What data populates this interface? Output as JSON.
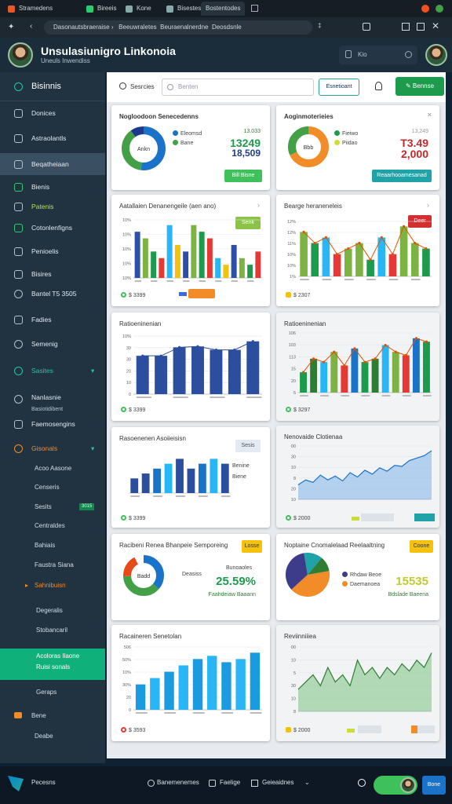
{
  "browser": {
    "tabs": [
      {
        "label": "Stramedens"
      },
      {
        "label": "Bireeis"
      },
      {
        "label": "Kone"
      },
      {
        "label": "Bisestes"
      },
      {
        "label": "Bostentodes"
      }
    ],
    "url": "Dasonautsbraeraise",
    "url_parts": [
      "Beeuwraletes",
      "Beuraenalnerdne",
      "Deosdsnle"
    ]
  },
  "app": {
    "title": "Unsulasiunigro Linkonoia",
    "subtitle": "Uneuls Inwendiss",
    "search_chip": "Kio"
  },
  "sidebar": {
    "header": "Bisinnis",
    "items": [
      {
        "label": "Donices"
      },
      {
        "label": "Astraolantls"
      },
      {
        "label": "Beqatheiaan"
      },
      {
        "label": "Bienis"
      },
      {
        "label": "Patenis"
      },
      {
        "label": "Cotonlenfigns"
      },
      {
        "label": "Penioelis"
      },
      {
        "label": "Bisires"
      },
      {
        "label": "Bantel T5 3505"
      },
      {
        "label": "Fadies"
      },
      {
        "label": "Semenig"
      },
      {
        "label": "Sasites"
      },
      {
        "label": "Nanlasnie"
      },
      {
        "label": "Basiotidibent"
      },
      {
        "label": "Faemosengins"
      },
      {
        "label": "Gisonals"
      }
    ],
    "sub_items": [
      {
        "label": "Acoo Aasone"
      },
      {
        "label": "Censeris"
      },
      {
        "label": "Sesits",
        "badge": "3015"
      },
      {
        "label": "Centraldes"
      },
      {
        "label": "Bahiais"
      },
      {
        "label": "Faustra Siana"
      },
      {
        "label": "Sahnibuisn"
      },
      {
        "label": "Degeralis"
      },
      {
        "label": "Stobancaril"
      },
      {
        "label": "Acoloras Ilaone"
      },
      {
        "label": "Ruisi sonals"
      },
      {
        "label": "Geraps"
      },
      {
        "label": "Bene"
      },
      {
        "label": "Deabe"
      }
    ]
  },
  "toolbar": {
    "search_label": "Sesrcies",
    "search_placeholder": "Benten",
    "filter_button": "Esnetioant",
    "primary_button": "Bennse"
  },
  "cards": [
    {
      "title": "Nogloodoon Senecedenns",
      "legend": [
        "Eleomsd",
        "Bane"
      ],
      "value1": "13.033",
      "value2": "13249",
      "value3": "18,509",
      "button": "Bill Bisne",
      "donut_center": "Ankn"
    },
    {
      "title": "Aoginmoterieies",
      "legend": [
        "Fieiwo",
        "Piidao"
      ],
      "value1": "13,249",
      "value2": "T3.49",
      "value3": "2,000",
      "button": "Reaarhooamesanad",
      "donut_center": "Bbb"
    },
    {
      "title": "Aatallaien Denanengeile (aen ano)",
      "badge": "Senk",
      "footer": "$ 3399"
    },
    {
      "title": "Bearge heraneneleis",
      "badge": "Deer",
      "footer": "$ 2307"
    },
    {
      "title": "Ratioeninenian",
      "footer": "$ 3399"
    },
    {
      "title": "Ratioeninenian",
      "footer": "$ 3297"
    },
    {
      "title": "Rasoenenen Asoiieisisn",
      "badge": "Sesis",
      "legend": [
        "Benine",
        "Biene"
      ],
      "footer": "$ 3399"
    },
    {
      "title": "Nenovaide Clotienaa",
      "footer": "$ 2000"
    },
    {
      "title": "Racibeni Renea Bhanpeie Semporeing",
      "badge": "Losse",
      "legend": [
        "Deasiss",
        "Bunoaoles"
      ],
      "value": "25.59%",
      "sub": "Faahdeiaw Baaann",
      "donut_center": "Badd"
    },
    {
      "title": "Noptaine Cnomalelaad Reelaaltning",
      "badge": "Coone",
      "legend": [
        "Rhdaw Beoe",
        "Daemanoea"
      ],
      "value": "15535",
      "sub": "Bdslade Baeena"
    },
    {
      "title": "Racaineren Senetolan",
      "footer": "$ 3593"
    },
    {
      "title": "Reviinniiiea",
      "footer": "$ 2000"
    }
  ],
  "bottom": {
    "app_label": "Pecesns",
    "items": [
      "Banemenemes",
      "Faelige",
      "Geieaidnes"
    ],
    "primary": "Bone"
  },
  "chart_data": [
    {
      "type": "bar",
      "title": "Aatallaien Denanengeile (aen ano)",
      "yticks": [
        "10%",
        "10%",
        "10%",
        "10%",
        "10%"
      ],
      "series": [
        {
          "values": [
            7,
            6,
            4,
            3,
            8,
            5,
            4,
            8,
            7,
            6,
            3,
            2,
            5,
            3,
            2,
            4
          ]
        }
      ]
    },
    {
      "type": "bar",
      "title": "Bearge heraneneleis",
      "yticks": [
        "12%",
        "12%",
        "11%",
        "10%",
        "10%",
        "1%"
      ],
      "series": [
        {
          "values": [
            8,
            6,
            7,
            4,
            5,
            6,
            3,
            7,
            4,
            9,
            6,
            5
          ]
        }
      ]
    },
    {
      "type": "bar",
      "title": "Ratioeninenian",
      "yticks": [
        "10%",
        "30",
        "30",
        "20",
        "10",
        "0"
      ],
      "series": [
        {
          "values": [
            4.5,
            4.5,
            5.5,
            5.6,
            5.2,
            5.2,
            6.2
          ]
        }
      ]
    },
    {
      "type": "bar",
      "title": "Ratioeninenian",
      "yticks": [
        "106",
        "103",
        "113",
        "15",
        "20",
        "5"
      ],
      "series": [
        {
          "values": [
            3,
            5,
            4.5,
            6,
            4,
            6.5,
            4.5,
            5,
            7,
            6,
            5.5,
            8,
            7.5
          ]
        }
      ]
    },
    {
      "type": "bar",
      "title": "Rasoenenen Asoiieisisn",
      "series": [
        {
          "values": [
            3,
            4,
            5,
            6,
            7,
            5,
            6,
            7,
            6
          ]
        }
      ]
    },
    {
      "type": "area",
      "title": "Nenovaide Clotienaa",
      "yticks": [
        "00",
        "30",
        "10",
        "8",
        "20",
        "10"
      ],
      "series": [
        {
          "values": [
            3,
            4,
            3.5,
            5,
            4,
            4.8,
            3.8,
            5.5,
            4.6,
            6,
            5.2,
            6.5,
            5.8,
            7,
            6.8,
            8,
            8.5,
            9,
            10
          ]
        }
      ]
    },
    {
      "type": "bar",
      "title": "Racaineren Senetolan",
      "yticks": [
        "506",
        "50%",
        "10%",
        "30%",
        "20",
        "0"
      ],
      "series": [
        {
          "values": [
            4,
            5,
            6,
            7,
            8,
            8.5,
            7.5,
            8,
            9
          ]
        }
      ]
    },
    {
      "type": "area",
      "title": "Reviinniiiea",
      "yticks": [
        "00",
        "10",
        "5",
        "30",
        "10",
        "8"
      ],
      "series": [
        {
          "values": [
            3,
            4,
            5,
            3.5,
            6,
            4,
            5,
            3.5,
            7,
            5,
            6,
            4.5,
            6,
            5,
            6.5,
            5.5,
            7,
            6,
            8
          ]
        }
      ]
    }
  ]
}
